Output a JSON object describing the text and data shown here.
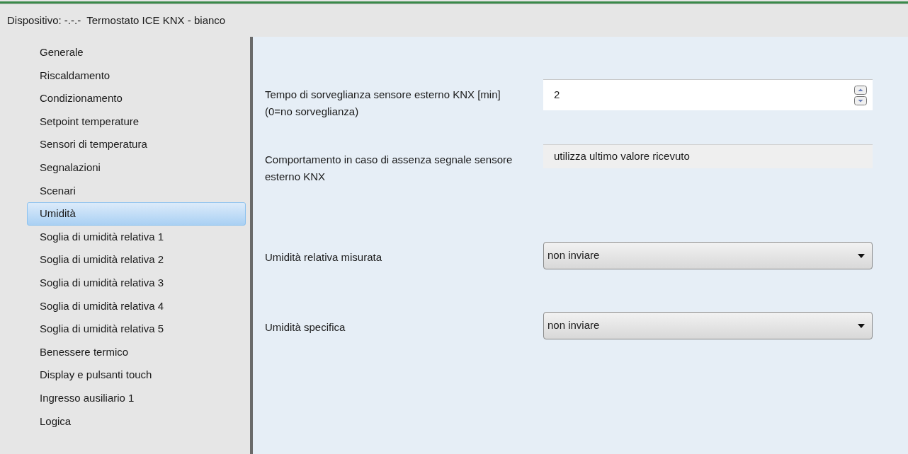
{
  "window": {
    "title": "Dispositivo: -.-.-  Termostato ICE KNX - bianco"
  },
  "sidebar": {
    "items": [
      {
        "label": "Generale",
        "selected": false
      },
      {
        "label": "Riscaldamento",
        "selected": false
      },
      {
        "label": "Condizionamento",
        "selected": false
      },
      {
        "label": "Setpoint temperature",
        "selected": false
      },
      {
        "label": "Sensori di temperatura",
        "selected": false
      },
      {
        "label": "Segnalazioni",
        "selected": false
      },
      {
        "label": "Scenari",
        "selected": false
      },
      {
        "label": "Umidità",
        "selected": true
      },
      {
        "label": "Soglia di umidità relativa 1",
        "selected": false
      },
      {
        "label": "Soglia di umidità relativa 2",
        "selected": false
      },
      {
        "label": "Soglia di umidità relativa 3",
        "selected": false
      },
      {
        "label": "Soglia di umidità relativa 4",
        "selected": false
      },
      {
        "label": "Soglia di umidità relativa 5",
        "selected": false
      },
      {
        "label": "Benessere termico",
        "selected": false
      },
      {
        "label": "Display e pulsanti touch",
        "selected": false
      },
      {
        "label": "Ingresso ausiliario 1",
        "selected": false
      },
      {
        "label": "Logica",
        "selected": false
      }
    ]
  },
  "parameters": [
    {
      "kind": "spin",
      "label": "Tempo di sorveglianza sensore esterno KNX [min] (0=no sorveglianza)",
      "value": "2"
    },
    {
      "kind": "readonly",
      "label": "Comportamento in caso di assenza segnale sensore esterno KNX",
      "value": "utilizza ultimo valore ricevuto"
    },
    {
      "kind": "dropdown",
      "label": "Umidità relativa misurata",
      "value": "non inviare"
    },
    {
      "kind": "dropdown",
      "label": "Umidità specifica",
      "value": "non inviare"
    }
  ]
}
